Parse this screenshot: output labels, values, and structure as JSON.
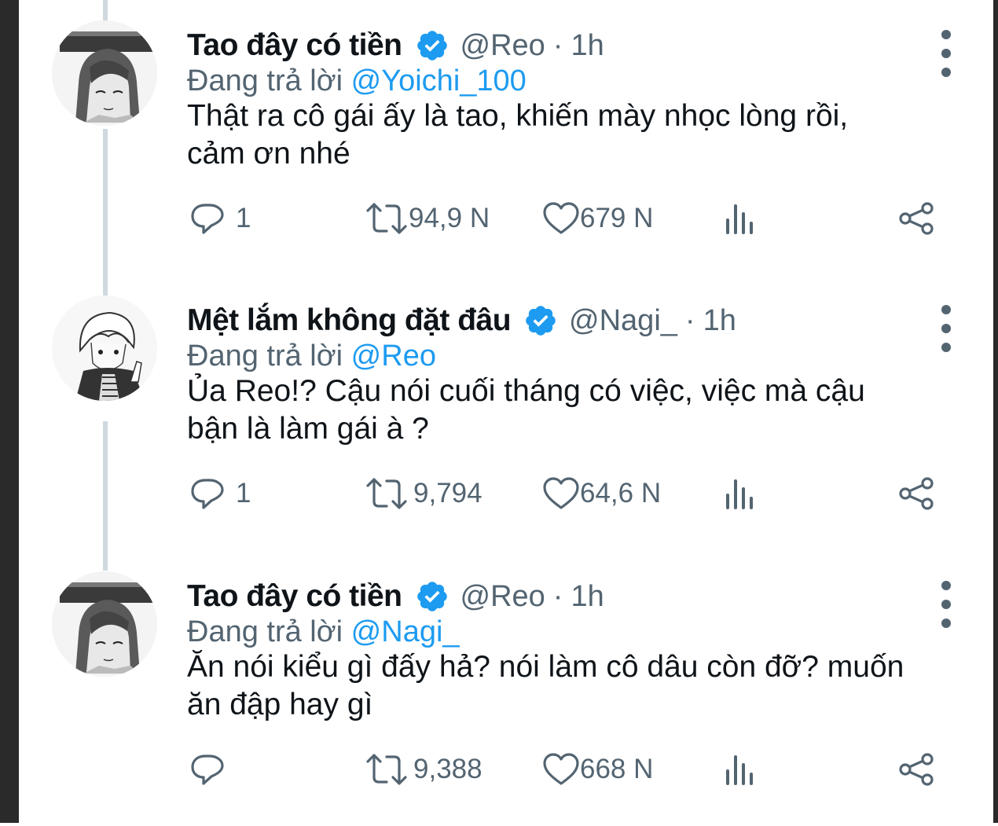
{
  "accent_color": "#1d9bf0",
  "tweets": [
    {
      "name": "Tao đây có tiền",
      "handle": "@Reo",
      "time": "1h",
      "replying_label": "Đang trả lời",
      "replying_to": "@Yoichi_100",
      "text_line1": "Thật ra cô gái ấy là tao, khiến mày nhọc lòng rồi,",
      "text_line2": "cảm ơn nhé",
      "replies": "1",
      "retweets": "94,9 N",
      "likes": "679 N",
      "avatar_icon": "anime-avatar-reo"
    },
    {
      "name": "Mệt lắm không đặt đâu",
      "handle": "@Nagi_",
      "time": "1h",
      "replying_label": "Đang trả lời",
      "replying_to": "@Reo",
      "text_line1": "Ủa Reo!? Cậu nói cuối tháng có việc, việc mà cậu",
      "text_line2": "bận là làm gái à ?",
      "replies": "1",
      "retweets": "9,794",
      "likes": "64,6 N",
      "avatar_icon": "anime-avatar-nagi"
    },
    {
      "name": "Tao đây có tiền",
      "handle": "@Reo",
      "time": "1h",
      "replying_label": "Đang trả lời",
      "replying_to": "@Nagi_",
      "text_line1": "Ăn nói kiểu gì đấy hả? nói làm cô dâu còn đỡ? muốn",
      "text_line2": "ăn đập hay gì",
      "replies": "",
      "retweets": "9,388",
      "likes": "668 N",
      "avatar_icon": "anime-avatar-reo"
    }
  ]
}
